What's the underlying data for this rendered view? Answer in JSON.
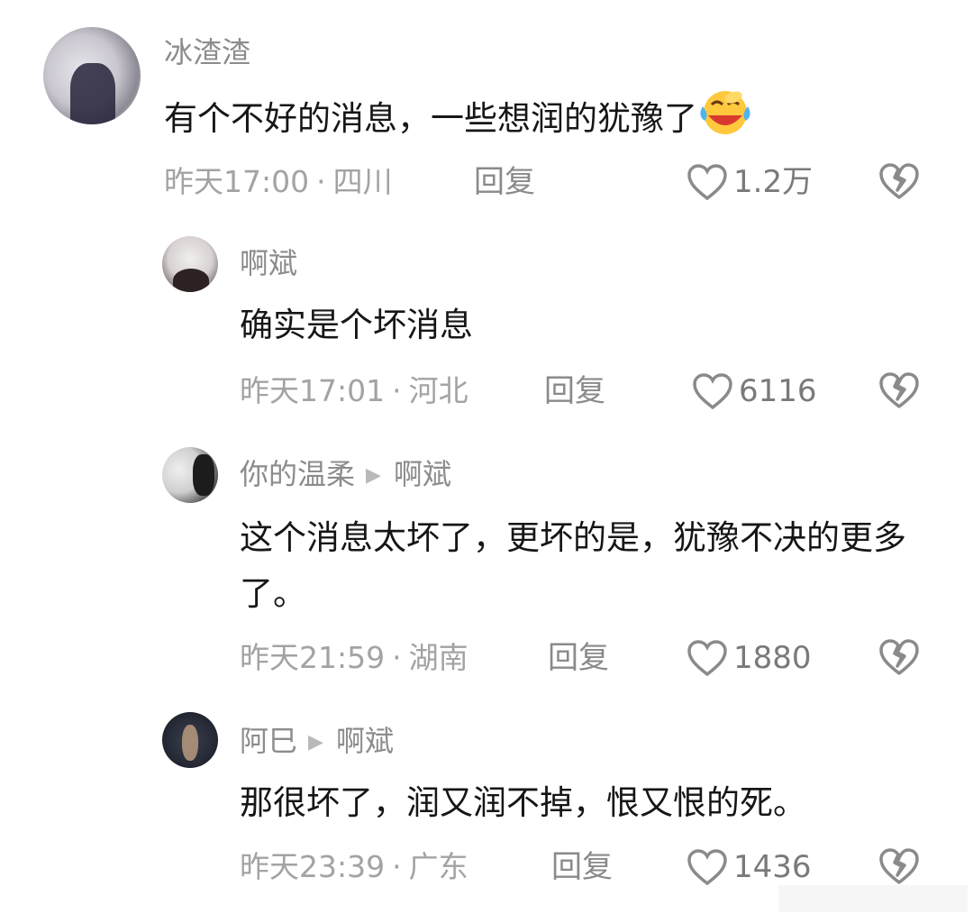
{
  "comments": [
    {
      "user": "冰渣渣",
      "text": "有个不好的消息，一些想润的犹豫了",
      "emoji": "laughing-crying-emoji",
      "time": "昨天17:00",
      "location": "四川",
      "reply_label": "回复",
      "likes": "1.2万"
    },
    {
      "user": "啊斌",
      "text": "确实是个坏消息",
      "time": "昨天17:01",
      "location": "河北",
      "reply_label": "回复",
      "likes": "6116"
    },
    {
      "user": "你的温柔",
      "reply_to": "啊斌",
      "text": "这个消息太坏了，更坏的是，犹豫不决的更多了。",
      "time": "昨天21:59",
      "location": "湖南",
      "reply_label": "回复",
      "likes": "1880"
    },
    {
      "user": "阿巳",
      "reply_to": "啊斌",
      "text": "那很坏了，润又润不掉，恨又恨的死。",
      "time": "昨天23:39",
      "location": "广东",
      "reply_label": "回复",
      "likes": "1436"
    }
  ],
  "separator": "·",
  "icons": {
    "like": "heart-outline-icon",
    "dislike": "broken-heart-icon",
    "reply_arrow": "triangle-right-icon"
  },
  "colors": {
    "text": "#161616",
    "meta": "#a3a3a3",
    "name": "#8c8c8c",
    "icon": "#8a8a8a"
  }
}
